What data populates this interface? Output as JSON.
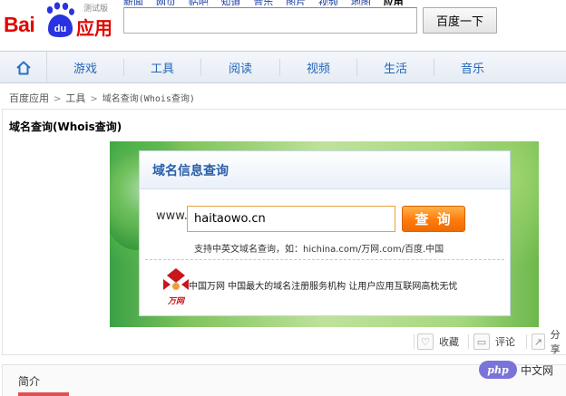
{
  "header": {
    "logo_text": "Bai",
    "logo_du": "du",
    "logo_app": "应用",
    "logo_test": "测试版",
    "top_links": [
      "新闻",
      "网页",
      "贴吧",
      "知道",
      "音乐",
      "图片",
      "视频",
      "地图",
      "应用"
    ],
    "search_value": "",
    "search_button": "百度一下"
  },
  "nav": {
    "items": [
      "游戏",
      "工具",
      "阅读",
      "视频",
      "生活",
      "音乐"
    ]
  },
  "breadcrumb": {
    "items": [
      "百度应用",
      "工具",
      "域名查询(Whois查询)"
    ]
  },
  "page": {
    "title": "域名查询(Whois查询)"
  },
  "widget": {
    "title": "域名信息查询",
    "www_label": "www.",
    "domain_value": "haitaowo.cn",
    "query_button": "查 询",
    "support_text": "支持中英文域名查询，如：hichina.com/万网.com/百度.中国",
    "wanwang_logo_text": "万网",
    "wanwang_text": "中国万网  中国最大的域名注册服务机构  让用户应用互联网高枕无忧"
  },
  "actions": {
    "collect": "收藏",
    "comment": "评论",
    "share": "分享"
  },
  "intro": {
    "title": "简介"
  },
  "watermark": {
    "badge": "php",
    "text": "中文网"
  },
  "colors": {
    "brand_red": "#e10601",
    "brand_blue": "#2932e1",
    "nav_text": "#2266bb",
    "query_orange": "#ff7b0d"
  }
}
